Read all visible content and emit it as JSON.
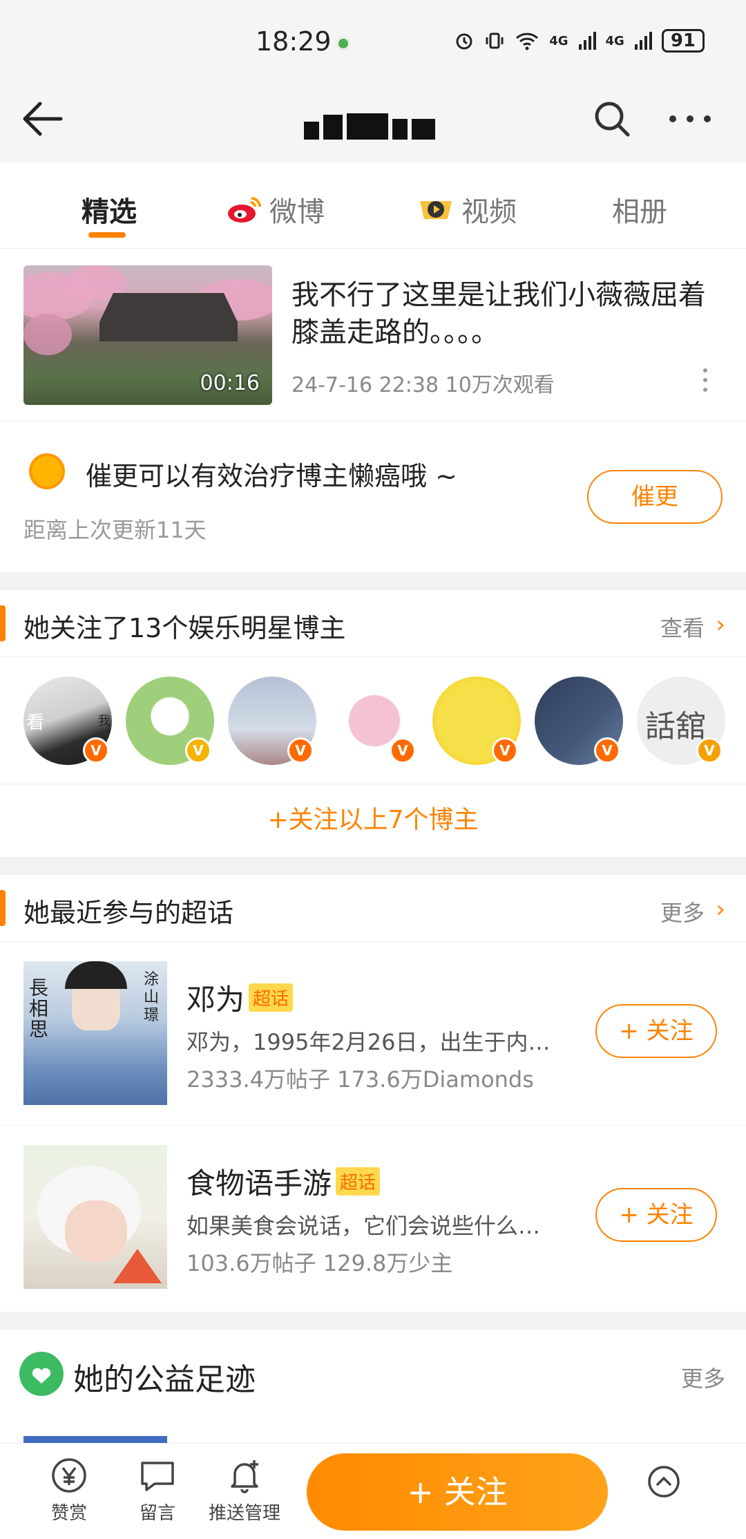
{
  "status_bar": {
    "time": "18:29",
    "battery": "91",
    "network_1": "4G",
    "network_2": "4G"
  },
  "nav": {
    "title": ""
  },
  "tabs": [
    {
      "label": "精选"
    },
    {
      "label": "微博"
    },
    {
      "label": "视频"
    },
    {
      "label": "相册"
    }
  ],
  "video": {
    "title": "我不行了这里是让我们小薇薇屈着膝盖走路的。。。。",
    "duration": "00:16",
    "meta": "24-7-16 22:38 10万次观看"
  },
  "urge": {
    "text": "催更可以有效治疗博主懒癌哦 ~",
    "sub": "距离上次更新11天",
    "button": "催更"
  },
  "follows": {
    "title": "她关注了13个娱乐明星博主",
    "link": "查看",
    "avatar_text_1": "看",
    "avatar_text_2": "我",
    "avatar_text_7": "話舘",
    "follow_all": "+关注以上7个博主",
    "colors": {
      "badge_orange": "#ff6a00",
      "badge_yellow": "#f5b400"
    }
  },
  "topics": {
    "title": "她最近参与的超话",
    "link": "更多",
    "badge": "超话",
    "follow_label": "+ 关注",
    "items": [
      {
        "name": "邓为",
        "desc": "邓为，1995年2月26日，出生于内…",
        "stats": "2333.4万帖子 173.6万Diamonds",
        "thumb_text_1": "長相思",
        "thumb_text_2": "涂山璟"
      },
      {
        "name": "食物语手游",
        "desc": "如果美食会说话，它们会说些什么…",
        "stats": "103.6万帖子 129.8万少主"
      }
    ]
  },
  "charity": {
    "title": "她的公益足迹",
    "more": "更多"
  },
  "bottom_bar": {
    "reward": "赞赏",
    "comment": "留言",
    "push": "推送管理",
    "follow": "+ 关注",
    "brand_color": "#ff8200"
  }
}
